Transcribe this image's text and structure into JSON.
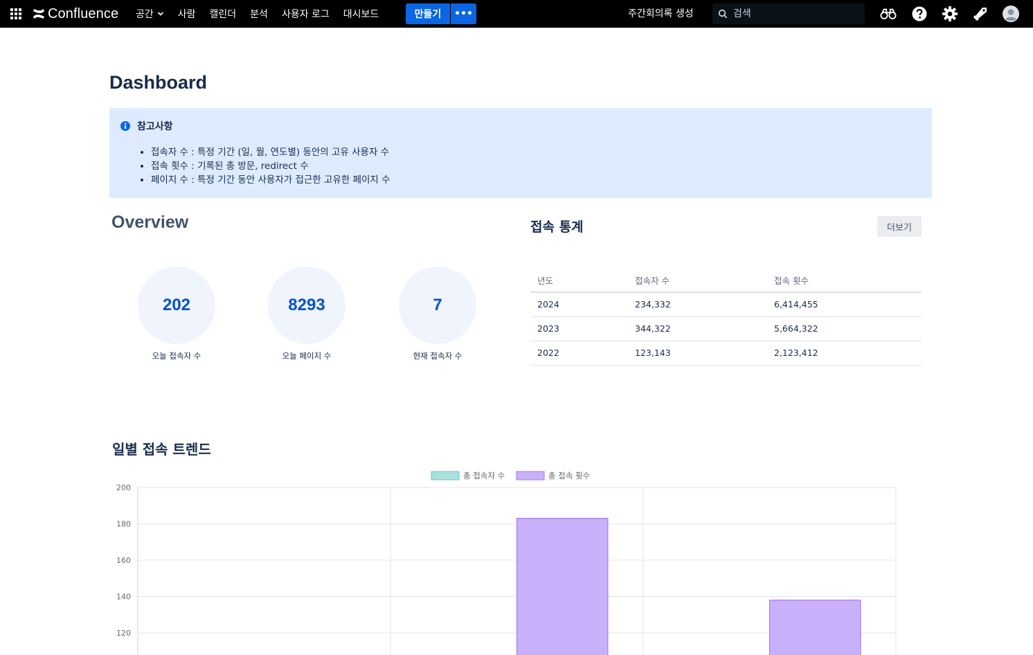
{
  "nav": {
    "logo": "Confluence",
    "items": [
      {
        "label": "공간",
        "dropdown": true
      },
      {
        "label": "사람"
      },
      {
        "label": "캘린더"
      },
      {
        "label": "분석"
      },
      {
        "label": "사용자 로그"
      },
      {
        "label": "대시보드"
      }
    ],
    "create_label": "만들기",
    "more_label": "•••",
    "meeting_label": "주간회의록 생성",
    "search_placeholder": "검색",
    "icons": [
      "binoculars-icon",
      "help-icon",
      "settings-icon",
      "notifications-icon",
      "avatar-icon"
    ]
  },
  "page": {
    "title": "Dashboard"
  },
  "info": {
    "title": "참고사항",
    "items": [
      "접속자 수 : 특정 기간 (일, 월, 연도별) 동안의 고유 사용자 수",
      "접속 횟수 : 기록된 총 방문, redirect 수",
      "페이지 수 : 특정 기간 동안 사용자가 접근한 고유한 페이지 수"
    ]
  },
  "overview": {
    "title": "Overview",
    "stats": [
      {
        "value": "202",
        "label": "오늘 접속자 수"
      },
      {
        "value": "8293",
        "label": "오늘 페이지 수"
      },
      {
        "value": "7",
        "label": "현재 접속자 수"
      }
    ]
  },
  "access_stats": {
    "title": "접속 통계",
    "more_label": "더보기",
    "columns": [
      "년도",
      "접속자 수",
      "접속 횟수"
    ],
    "rows": [
      [
        "2024",
        "234,332",
        "6,414,455"
      ],
      [
        "2023",
        "344,322",
        "5,664,322"
      ],
      [
        "2022",
        "123,143",
        "2,123,412"
      ]
    ]
  },
  "trend": {
    "title": "일별 접속 트렌드"
  },
  "chart_data": {
    "type": "bar",
    "legend_position": "top",
    "grid": true,
    "series": [
      {
        "name": "총 접속자 수",
        "color": "#a8e0dc",
        "border": "#6cc5bf",
        "values": [
          null,
          null,
          null
        ]
      },
      {
        "name": "총 접속 횟수",
        "color": "#c9b0fb",
        "border": "#a77af0",
        "values": [
          null,
          183,
          138
        ]
      }
    ],
    "category_count": 3,
    "ylim": [
      100,
      200
    ],
    "y_ticks": [
      120,
      140,
      160,
      180,
      200
    ]
  },
  "colors": {
    "accent": "#0c66e4",
    "info_bg": "#deebff",
    "stat_value": "#0052cc"
  }
}
